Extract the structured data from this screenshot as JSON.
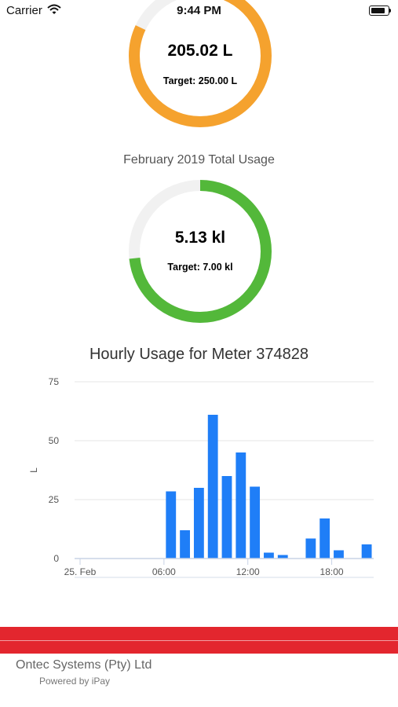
{
  "status_bar": {
    "carrier": "Carrier",
    "time": "9:44 PM"
  },
  "daily_gauge": {
    "value": "205.02 L",
    "target": "Target: 250.00 L",
    "fraction": 0.82,
    "color": "#f5a22e"
  },
  "monthly": {
    "title": "February 2019 Total Usage",
    "value": "5.13 kl",
    "target": "Target: 7.00 kl",
    "fraction": 0.733,
    "color": "#53b83a"
  },
  "hourly_chart": {
    "title": "Hourly Usage for Meter 374828"
  },
  "chart_data": {
    "type": "bar",
    "title": "Hourly Usage for Meter 374828",
    "xlabel": "",
    "ylabel": "L",
    "ylim": [
      0,
      75
    ],
    "yticks": [
      0,
      25,
      50,
      75
    ],
    "x_tick_labels": [
      {
        "hour": 0,
        "label": "25. Feb"
      },
      {
        "hour": 6,
        "label": "06:00"
      },
      {
        "hour": 12,
        "label": "12:00"
      },
      {
        "hour": 18,
        "label": "18:00"
      }
    ],
    "hours": [
      0,
      1,
      2,
      3,
      4,
      5,
      6,
      7,
      8,
      9,
      10,
      11,
      12,
      13,
      14,
      15,
      16,
      17,
      18,
      19,
      20
    ],
    "values": [
      0,
      0,
      0,
      0,
      0,
      0,
      28.5,
      12,
      30,
      61,
      35,
      45,
      30.5,
      2.5,
      1.5,
      0,
      8.5,
      17,
      3.5,
      0,
      6
    ],
    "bar_color": "#1f7ef7",
    "grid": true
  },
  "footer": {
    "company": "Ontec Systems (Pty) Ltd",
    "powered": "Powered by iPay",
    "band_color": "#e3262e"
  }
}
